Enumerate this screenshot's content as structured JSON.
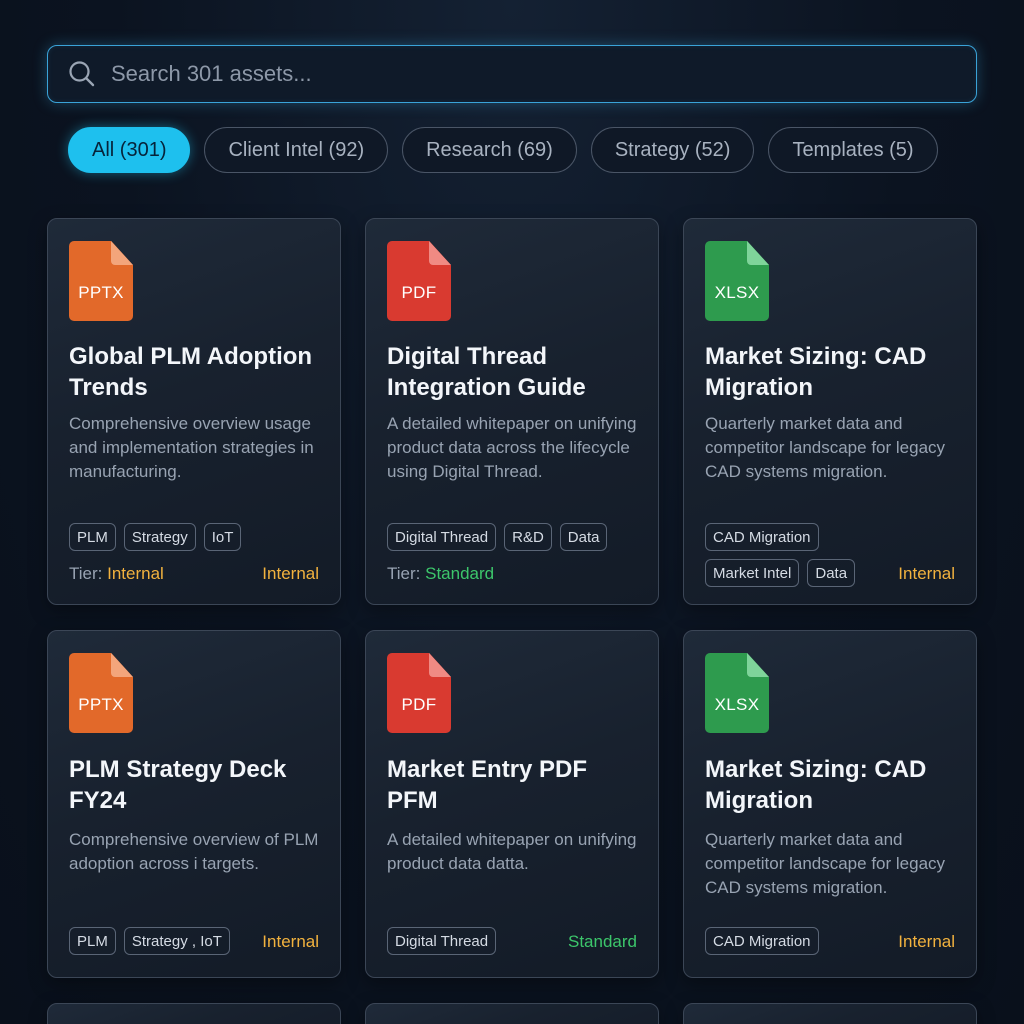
{
  "search": {
    "placeholder": "Search 301 assets..."
  },
  "filters": [
    {
      "label": "All (301)",
      "active": true
    },
    {
      "label": "Client Intel (92)",
      "active": false
    },
    {
      "label": "Research (69)",
      "active": false
    },
    {
      "label": "Strategy (52)",
      "active": false
    },
    {
      "label": "Templates (5)",
      "active": false
    }
  ],
  "cards": [
    {
      "file_type": "PPTX",
      "title": "Global PLM Adoption Trends",
      "description": "Comprehensive overview usage and implementation strategies in manufacturing.",
      "tags": [
        "PLM",
        "Strategy",
        "IoT"
      ],
      "tier_label": "Tier:",
      "tier_value": "Internal",
      "access": "Internal"
    },
    {
      "file_type": "PDF",
      "title": "Digital Thread Integration Guide",
      "description": "A detailed whitepaper on unifying product data across the lifecycle using Digital Thread.",
      "tags": [
        "Digital Thread",
        "R&D",
        "Data"
      ],
      "tier_label": "Tier:",
      "tier_value": "Standard"
    },
    {
      "file_type": "XLSX",
      "title": "Market Sizing: CAD Migration",
      "description": "Quarterly market data and competitor landscape for legacy CAD systems migration.",
      "tags": [
        "CAD Migration",
        "Market Intel",
        "Data"
      ],
      "access": "Internal"
    },
    {
      "file_type": "PPTX",
      "title": "PLM Strategy Deck FY24",
      "description": "Comprehensive overview of PLM adoption across i targets.",
      "tags": [
        "PLM",
        "Strategy , IoT"
      ],
      "access": "Internal"
    },
    {
      "file_type": "PDF",
      "title": "Market Entry PDF PFM",
      "description": "A detailed whitepaper on unifying product data datta.",
      "tags": [
        "Digital Thread"
      ],
      "access": "Standard"
    },
    {
      "file_type": "XLSX",
      "title": "Market Sizing: CAD Migration",
      "description": "Quarterly market data and competitor landscape for legacy CAD systems migration.",
      "tags": [
        "CAD Migration"
      ],
      "access": "Internal"
    }
  ],
  "colors": {
    "accent": "#1ec0ee",
    "internal": "#f2b23e",
    "standard": "#3cc66b",
    "pptx": "#e2692a",
    "pdf": "#d93a30",
    "xlsx": "#2e9b4e"
  },
  "icons": {
    "search": "search-icon",
    "file": "file-icon"
  }
}
